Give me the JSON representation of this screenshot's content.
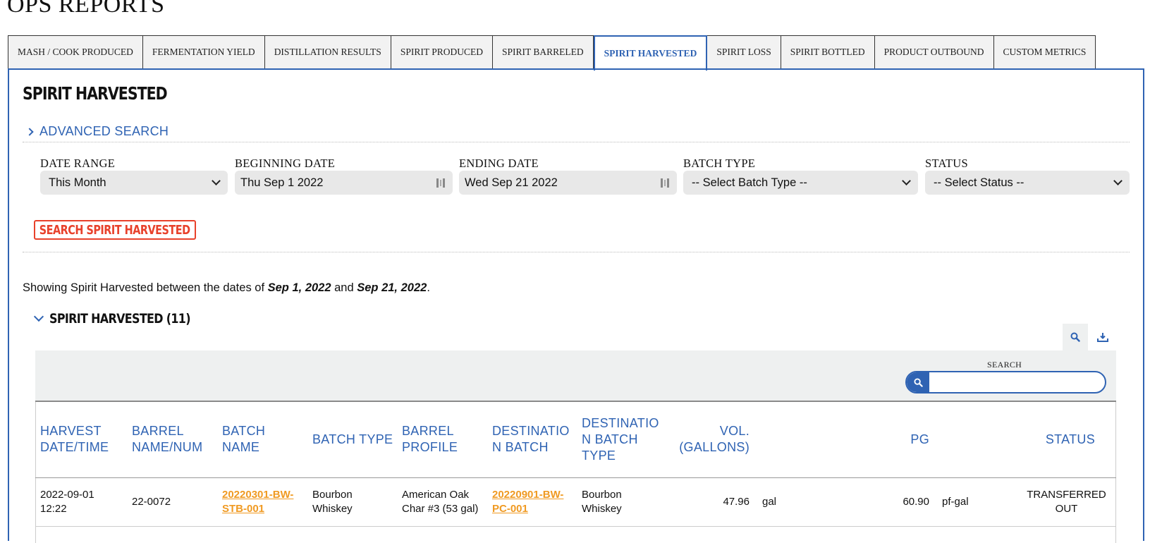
{
  "page": {
    "title": "OPS REPORTS"
  },
  "tabs": [
    {
      "label": "MASH / COOK PRODUCED"
    },
    {
      "label": "FERMENTATION YIELD"
    },
    {
      "label": "DISTILLATION RESULTS"
    },
    {
      "label": "SPIRIT PRODUCED"
    },
    {
      "label": "SPIRIT BARRELED"
    },
    {
      "label": "SPIRIT HARVESTED",
      "active": true
    },
    {
      "label": "SPIRIT LOSS"
    },
    {
      "label": "SPIRIT BOTTLED"
    },
    {
      "label": "PRODUCT OUTBOUND"
    },
    {
      "label": "CUSTOM METRICS"
    }
  ],
  "section": {
    "title": "SPIRIT HARVESTED"
  },
  "advanced_search": {
    "label": "ADVANCED SEARCH"
  },
  "filters": {
    "date_range": {
      "label": "DATE RANGE",
      "value": "This Month"
    },
    "beginning_date": {
      "label": "BEGINNING DATE",
      "value": "Thu Sep 1 2022"
    },
    "ending_date": {
      "label": "ENDING DATE",
      "value": "Wed Sep 21 2022"
    },
    "batch_type": {
      "label": "BATCH TYPE",
      "value": "-- Select Batch Type --"
    },
    "status": {
      "label": "STATUS",
      "value": "-- Select Status --"
    }
  },
  "search_button": {
    "label": "SEARCH SPIRIT HARVESTED"
  },
  "summary": {
    "prefix": "Showing Spirit Harvested between the dates of ",
    "start": "Sep 1, 2022",
    "middle": " and ",
    "end": "Sep 21, 2022",
    "suffix": "."
  },
  "group": {
    "title": "SPIRIT HARVESTED (11)"
  },
  "table_search": {
    "label": "SEARCH",
    "value": ""
  },
  "columns": {
    "harvest": [
      "HARVEST",
      "DATE/TIME"
    ],
    "barrel": [
      "BARREL",
      "NAME/NUM"
    ],
    "batch_name": [
      "BATCH",
      "NAME"
    ],
    "batch_type": [
      "BATCH TYPE"
    ],
    "barrel_profile": [
      "BARREL",
      "PROFILE"
    ],
    "dest_batch": [
      "DESTINATIO",
      "N BATCH"
    ],
    "dest_batch_type": [
      "DESTINATIO",
      "N BATCH",
      "TYPE"
    ],
    "vol": [
      "VOL.",
      "(GALLONS)"
    ],
    "pg": [
      "PG"
    ],
    "status": [
      "STATUS"
    ]
  },
  "rows": [
    {
      "harvest": [
        "2022-09-01",
        "12:22"
      ],
      "barrel": "22-0072",
      "batch_name": [
        "20220301-BW-",
        "STB-001"
      ],
      "batch_type": [
        "Bourbon",
        "Whiskey"
      ],
      "barrel_profile": [
        "American Oak",
        "Char #3 (53 gal)"
      ],
      "dest_batch": [
        "20220901-BW-",
        "PC-001"
      ],
      "dest_batch_type": [
        "Bourbon",
        "Whiskey"
      ],
      "vol": "47.96",
      "vol_unit": "gal",
      "pg": "60.90",
      "pg_unit": "pf-gal",
      "status": [
        "TRANSFERRED",
        "OUT"
      ]
    }
  ],
  "colors": {
    "accent": "#2f63b3",
    "button_red": "#e8412b",
    "link_orange": "#f09a22"
  }
}
